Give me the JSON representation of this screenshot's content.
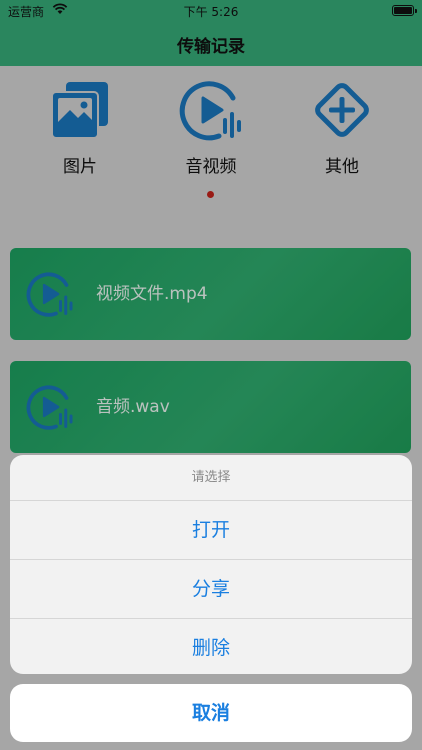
{
  "status": {
    "carrier": "运营商",
    "time": "下午 5:26"
  },
  "nav": {
    "title": "传输记录"
  },
  "categories": [
    {
      "label": "图片",
      "icon": "image-icon"
    },
    {
      "label": "音视频",
      "icon": "media-play-icon"
    },
    {
      "label": "其他",
      "icon": "other-plus-icon"
    }
  ],
  "files": [
    {
      "name": "视频文件.mp4",
      "icon": "media-play-icon"
    },
    {
      "name": "音频.wav",
      "icon": "media-play-icon"
    }
  ],
  "action_sheet": {
    "title": "请选择",
    "actions": [
      "打开",
      "分享",
      "删除"
    ],
    "cancel": "取消"
  },
  "colors": {
    "nav": "#35a876",
    "accent": "#1a7fe0",
    "icon": "#1a73b8",
    "file_bg": "#1f9d5e",
    "dot": "#c0221b"
  }
}
